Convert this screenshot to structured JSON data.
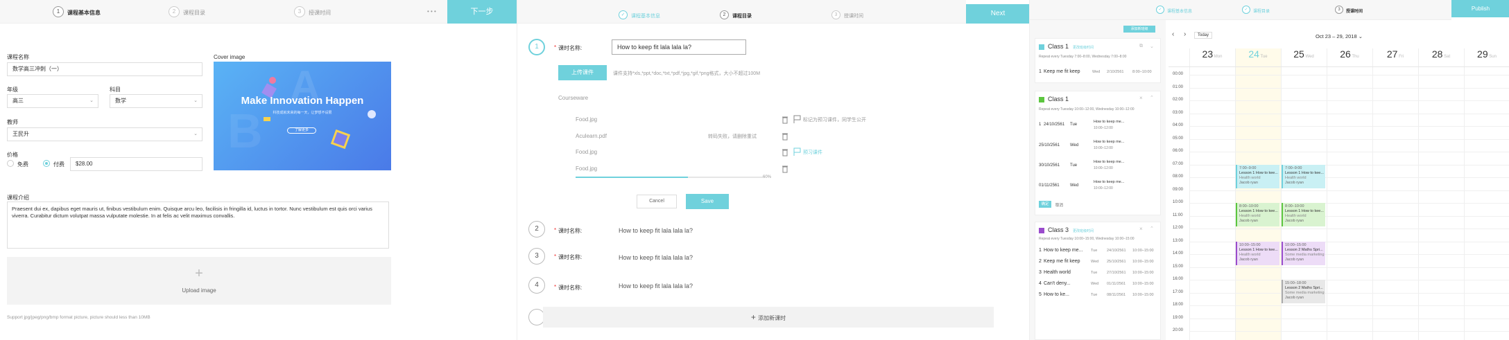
{
  "colors": {
    "accent": "#6fd1dc",
    "green": "#5cc63f",
    "purple": "#9a4ccc",
    "gray_event": "#e6e6e6"
  },
  "p1": {
    "steps": [
      {
        "num": "1",
        "label": "课程基本信息"
      },
      {
        "num": "2",
        "label": "课程目录"
      },
      {
        "num": "3",
        "label": "授课时间"
      }
    ],
    "dots": "• • •",
    "next": "下一步",
    "name_label": "课程名称",
    "name_value": "数学高三冲刺（一）",
    "cover_label": "Cover image",
    "banner": {
      "title": "Make Innovation Happen",
      "subtitle": "科技成就未来的每一天，让梦想不设限",
      "btn": "了解更多"
    },
    "grade_label": "年级",
    "grade_value": "高三",
    "subject_label": "科目",
    "subject_value": "数学",
    "teacher_label": "教师",
    "teacher_value": "王民升",
    "price_label": "价格",
    "free": "免费",
    "paid": "付费",
    "price_value": "$28.00",
    "intro_label": "课程介绍",
    "intro_text": "Praesent dui ex, dapibus eget mauris ut, finibus vestibulum enim. Quisque arcu leo, facilisis in fringilla id, luctus in tortor. Nunc vestibulum est quis orci varius viverra. Curabitur dictum volutpat massa vulputate molestie. In at felis ac velit maximus convallis.",
    "plus": "+",
    "upload": "Upload image",
    "support": "Support jpg/jpeg/png/bmp format picture, picture should less than 10MB"
  },
  "p2": {
    "steps": [
      {
        "num": "✓",
        "label": "课程基本信息"
      },
      {
        "num": "2",
        "label": "课程目录"
      },
      {
        "num": "3",
        "label": "授课时间"
      }
    ],
    "next": "Next",
    "req": "*",
    "lesson_label": "课时名称:",
    "lesson1_value": "How to keep fit lala lala la?",
    "upload_btn": "上传课件",
    "upload_hint": "课件支持*xls,*ppt,*doc,*txt,*pdf,*jpg,*gif,*png格式，大小不超过100M",
    "courseware": "Courseware",
    "files": [
      {
        "name": "Food.jpg",
        "status": "",
        "action": "标记为预习课件，同学生公开"
      },
      {
        "name": "Aculearn.pdf",
        "status": "转码失败，请删除重试",
        "action": ""
      },
      {
        "name": "Food.jpg",
        "status": "",
        "action": "预习课件"
      },
      {
        "name": "Food.jpg",
        "status": "",
        "action": ""
      }
    ],
    "progress": 0.6,
    "progress_text": "60%",
    "cancel": "Cancel",
    "save": "Save",
    "lessons": [
      {
        "num": "1"
      },
      {
        "num": "2",
        "value": "How to keep fit lala lala la?"
      },
      {
        "num": "3",
        "value": "How to keep fit lala lala la?"
      },
      {
        "num": "4",
        "value": "How to keep fit lala lala la?"
      }
    ],
    "add": "添加新课时"
  },
  "p3": {
    "steps": [
      {
        "num": "✓",
        "label": "课程基本信息"
      },
      {
        "num": "✓",
        "label": "课程目录"
      },
      {
        "num": "3",
        "label": "授课时间"
      }
    ],
    "publish": "Publish",
    "add_class": "添加新班级",
    "class_a": {
      "name": "Class 1",
      "link": "更改班级时间",
      "repeat": "Repeat every Tuesday 7:00–8:00, Wednesday 7:00–8:00",
      "rows": [
        {
          "n": "1",
          "t": "Keep me fit keep",
          "d": "Wed",
          "date": "2/10/2561",
          "time": "8:00–10:00"
        }
      ]
    },
    "class_b": {
      "name": "Class 1",
      "repeat": "Repeat every Tuesday 10:00–12:00, Wednesday 10:00–12:00",
      "rows": [
        {
          "n": "1",
          "date": "24/10/2561",
          "d": "Tue",
          "t1": "How to keep me...",
          "t2": "10:00–12:00"
        },
        {
          "n": "",
          "date": "25/10/2561",
          "d": "Wed",
          "t1": "How to keep me...",
          "t2": "10:00–12:00"
        },
        {
          "n": "",
          "date": "30/10/2561",
          "d": "Tue",
          "t1": "How to keep me...",
          "t2": "10:00–12:00"
        },
        {
          "n": "",
          "date": "01/11/2561",
          "d": "Wed",
          "t1": "How to keep me...",
          "t2": "10:00–12:00"
        }
      ],
      "ok": "确定",
      "cancel": "取消"
    },
    "class_c": {
      "name": "Class 3",
      "link": "更改班级时间",
      "repeat": "Repeat every Tuesday 10:00–15:00, Wednesday 10:00–15:00",
      "rows": [
        {
          "n": "1",
          "t": "How to keep me...",
          "d": "Tue",
          "date": "24/10/2561",
          "time": "10:00–15:00"
        },
        {
          "n": "2",
          "t": "Keep me fit keep",
          "d": "Wed",
          "date": "25/10/2561",
          "time": "10:00–15:00"
        },
        {
          "n": "3",
          "t": "Health world",
          "d": "Tue",
          "date": "27/10/2561",
          "time": "10:00–15:00"
        },
        {
          "n": "4",
          "t": "Can't deny...",
          "d": "Wed",
          "date": "01/11/2561",
          "time": "10:00–15:00"
        },
        {
          "n": "5",
          "t": "How to ke...",
          "d": "Tue",
          "date": "08/11/2561",
          "time": "10:00–15:00"
        }
      ]
    },
    "nav_prev": "‹",
    "nav_next": "›",
    "today": "Today",
    "range": "Oct 23 – 29, 2018 ⌄",
    "days": [
      {
        "n": "23",
        "s": "Mon"
      },
      {
        "n": "24",
        "s": "Tue"
      },
      {
        "n": "25",
        "s": "Wed"
      },
      {
        "n": "26",
        "s": "Thu"
      },
      {
        "n": "27",
        "s": "Fri"
      },
      {
        "n": "28",
        "s": "Sat"
      },
      {
        "n": "29",
        "s": "Sun"
      }
    ],
    "times": [
      "00:00",
      "01:00",
      "02:00",
      "03:00",
      "04:00",
      "05:00",
      "06:00",
      "07:00",
      "08:00",
      "09:00",
      "10:00",
      "11:00",
      "12:00",
      "13:00",
      "14:00",
      "15:00",
      "16:00",
      "17:00",
      "18:00",
      "19:00",
      "20:00"
    ],
    "events": [
      {
        "day": 1,
        "start": 7,
        "end": 9,
        "color": "teal",
        "time": "7:00–9:00",
        "title": "Lesson 1 How to kee...",
        "sub": "Health world",
        "who": "Jacob ryan"
      },
      {
        "day": 2,
        "start": 7,
        "end": 9,
        "color": "teal",
        "time": "7:00–9:00",
        "title": "Lesson 1 How to kee...",
        "sub": "Health world",
        "who": "Jacob ryan"
      },
      {
        "day": 1,
        "start": 10,
        "end": 12,
        "color": "green",
        "time": "8:00–10:00",
        "title": "Lesson 1 How to kee...",
        "sub": "Health world",
        "who": "Jacob ryan"
      },
      {
        "day": 2,
        "start": 10,
        "end": 12,
        "color": "green",
        "time": "8:00–10:00",
        "title": "Lesson 1 How to kee...",
        "sub": "Health world",
        "who": "Jacob ryan"
      },
      {
        "day": 1,
        "start": 13,
        "end": 15,
        "color": "purple",
        "time": "10:00–15:00",
        "title": "Lesson 1 How to kee...",
        "sub": "Health world",
        "who": "Jacob ryan"
      },
      {
        "day": 2,
        "start": 13,
        "end": 15,
        "color": "purple",
        "time": "10:00–15:00",
        "title": "Lesson 2 Maths Spri...",
        "sub": "Some media marketing a...",
        "who": "Jacob ryan"
      },
      {
        "day": 2,
        "start": 16,
        "end": 18,
        "color": "gray",
        "time": "15:00–18:00",
        "title": "Lesson 2 Maths Spri...",
        "sub": "Some media marketing a...",
        "who": "Jacob ryan"
      }
    ]
  }
}
